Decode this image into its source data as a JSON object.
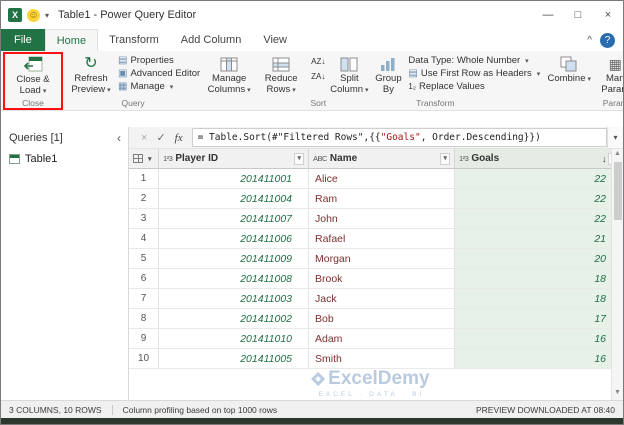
{
  "colors": {
    "file_tab_green": "#217346",
    "red_callout_box": "#ff1111",
    "goals_column_bg": "#e7f1e7",
    "number_text_green": "#1d7044",
    "name_text_maroon": "#7d2f2f",
    "formula_string_red": "#a31515"
  },
  "icons": {
    "excel": "X",
    "smiley": "☺",
    "caret": "▾",
    "collapse_left": "‹",
    "cancel": "×",
    "check": "✓",
    "sort_desc": "↓",
    "help": "?",
    "ribbon_collapse": "^",
    "scroll_up": "▲",
    "scroll_down": "▼",
    "refresh": "↻",
    "properties": "▤",
    "advanced_editor": "▣",
    "manage": "▦",
    "first_row": "▤",
    "replace": "1₂",
    "minimize": "—",
    "maximize": "□",
    "close": "×"
  },
  "titlebar": {
    "title": "Table1 - Power Query Editor"
  },
  "ribbon": {
    "tabs": [
      {
        "label": "File"
      },
      {
        "label": "Home"
      },
      {
        "label": "Transform"
      },
      {
        "label": "Add Column"
      },
      {
        "label": "View"
      }
    ],
    "close_group": {
      "button": [
        "Close &",
        "Load"
      ],
      "label": "Close"
    },
    "query_group": {
      "refresh": [
        "Refresh",
        "Preview"
      ],
      "properties": "Properties",
      "advanced_editor": "Advanced Editor",
      "manage": "Manage",
      "label": "Query"
    },
    "columns_group": {
      "manage_columns": [
        "Manage",
        "Columns"
      ],
      "reduce_rows": [
        "Reduce",
        "Rows"
      ]
    },
    "sort_group": {
      "az": "AZ↓",
      "za": "ZA↓",
      "label": "Sort"
    },
    "transform_group": {
      "split_column": [
        "Split",
        "Column"
      ],
      "group_by": [
        "Group",
        "By"
      ],
      "data_type": "Data Type: Whole Number",
      "first_row": "Use First Row as Headers",
      "replace_values": "Replace Values",
      "label": "Transform"
    },
    "combine_group": {
      "combine": "Combine"
    },
    "params_group": {
      "line1": "Man",
      "line2": "Param",
      "label": "Param"
    }
  },
  "queries_panel": {
    "header": "Queries [1]",
    "items": [
      {
        "label": "Table1"
      }
    ]
  },
  "formula_bar": {
    "fx": "fx",
    "prefix": "= Table.Sort(#\"Filtered Rows\",{{",
    "highlight": "\"Goals\"",
    "suffix": ", Order.Descending}})"
  },
  "grid": {
    "columns": [
      {
        "type": "1²3",
        "name": "Player ID"
      },
      {
        "type": "ABC",
        "name": "Name"
      },
      {
        "type": "1²3",
        "name": "Goals"
      }
    ],
    "rows": [
      {
        "n": "1",
        "player_id": "201411001",
        "name": "Alice",
        "goals": "22"
      },
      {
        "n": "2",
        "player_id": "201411004",
        "name": "Ram",
        "goals": "22"
      },
      {
        "n": "3",
        "player_id": "201411007",
        "name": "John",
        "goals": "22"
      },
      {
        "n": "4",
        "player_id": "201411006",
        "name": "Rafael",
        "goals": "21"
      },
      {
        "n": "5",
        "player_id": "201411009",
        "name": "Morgan",
        "goals": "20"
      },
      {
        "n": "6",
        "player_id": "201411008",
        "name": "Brook",
        "goals": "18"
      },
      {
        "n": "7",
        "player_id": "201411003",
        "name": "Jack",
        "goals": "18"
      },
      {
        "n": "8",
        "player_id": "201411002",
        "name": "Bob",
        "goals": "17"
      },
      {
        "n": "9",
        "player_id": "201411010",
        "name": "Adam",
        "goals": "16"
      },
      {
        "n": "10",
        "player_id": "201411005",
        "name": "Smith",
        "goals": "16"
      }
    ]
  },
  "watermark": {
    "brand": "ExcelDemy",
    "tagline": "EXCEL · DATA · BI"
  },
  "status_bar": {
    "columns_rows": "3 COLUMNS, 10 ROWS",
    "profiling": "Column profiling based on top 1000 rows",
    "preview": "PREVIEW DOWNLOADED AT 08:40"
  }
}
